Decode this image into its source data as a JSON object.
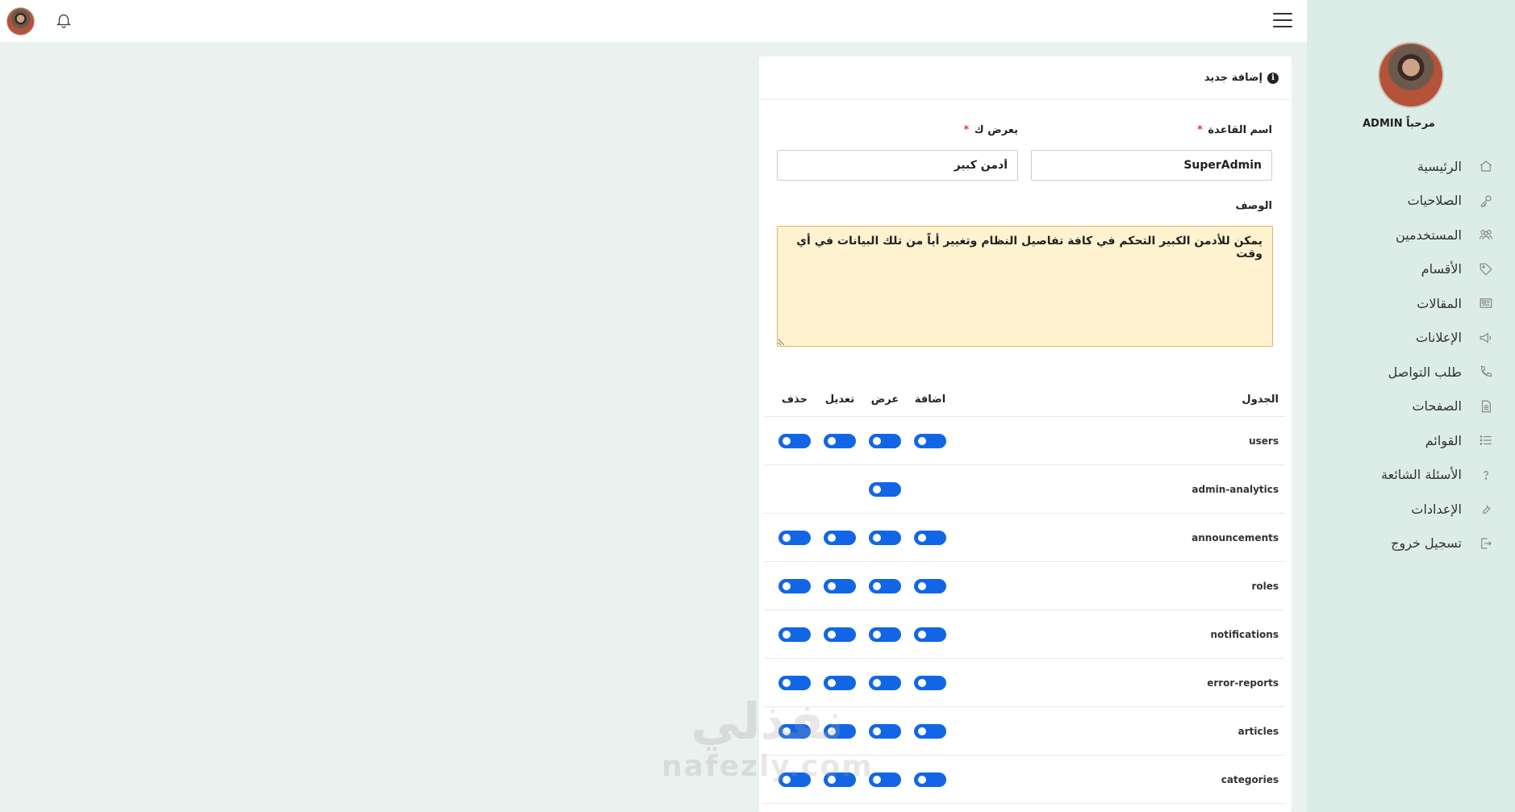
{
  "sidebar": {
    "welcome": "مرحباً ADMIN",
    "items": [
      {
        "label": "الرئيسية",
        "icon": "home-icon"
      },
      {
        "label": "الصلاحيات",
        "icon": "key-icon"
      },
      {
        "label": "المستخدمين",
        "icon": "users-icon"
      },
      {
        "label": "الأقسام",
        "icon": "tag-icon"
      },
      {
        "label": "المقالات",
        "icon": "newspaper-icon"
      },
      {
        "label": "الإعلانات",
        "icon": "megaphone-icon"
      },
      {
        "label": "طلب التواصل",
        "icon": "phone-icon"
      },
      {
        "label": "الصفحات",
        "icon": "file-icon"
      },
      {
        "label": "القوائم",
        "icon": "list-icon"
      },
      {
        "label": "الأسئلة الشائعة",
        "icon": "question-icon"
      },
      {
        "label": "الإعدادات",
        "icon": "wrench-icon"
      },
      {
        "label": "تسجيل خروج",
        "icon": "logout-icon"
      }
    ]
  },
  "card": {
    "title": "إضافة جديد",
    "rule_name_label": "اسم القاعدة",
    "rule_name_value": "SuperAdmin",
    "display_label": "يعرض ك",
    "display_value": "أدمن كبير",
    "required_mark": "*",
    "description_label": "الوصف",
    "description_value": "يمكن للأدمن الكبير التحكم في كافة تفاصيل النظام وتغيير أياً من تلك البيانات في أي وقت"
  },
  "permissions": {
    "headers": {
      "table": "الجدول",
      "add": "اضافة",
      "view": "عرض",
      "edit": "تعديل",
      "delete": "حذف"
    },
    "rows": [
      {
        "name": "users",
        "add": true,
        "view": true,
        "edit": true,
        "delete": true
      },
      {
        "name": "admin-analytics",
        "add": false,
        "view": true,
        "edit": false,
        "delete": false
      },
      {
        "name": "announcements",
        "add": true,
        "view": true,
        "edit": true,
        "delete": true
      },
      {
        "name": "roles",
        "add": true,
        "view": true,
        "edit": true,
        "delete": true
      },
      {
        "name": "notifications",
        "add": true,
        "view": true,
        "edit": true,
        "delete": true
      },
      {
        "name": "error-reports",
        "add": true,
        "view": true,
        "edit": true,
        "delete": true
      },
      {
        "name": "articles",
        "add": true,
        "view": true,
        "edit": true,
        "delete": true
      },
      {
        "name": "categories",
        "add": true,
        "view": true,
        "edit": true,
        "delete": true
      }
    ]
  },
  "watermark": {
    "arabic": "نفذلي",
    "latin": "nafezly.com"
  },
  "colors": {
    "toggle_on": "#1266e6",
    "sidebar_bg": "#dcece7",
    "page_bg": "#eaf1ef",
    "textarea_bg": "#fff2cf"
  }
}
